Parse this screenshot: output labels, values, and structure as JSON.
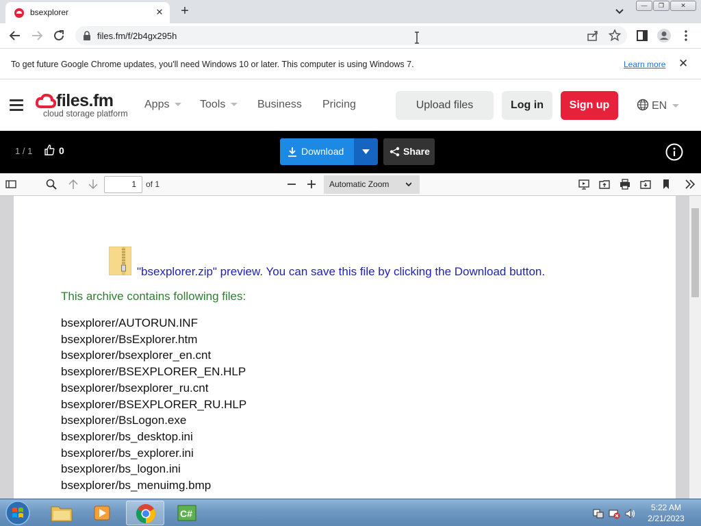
{
  "browser": {
    "tab_title": "bsexplorer",
    "url": "files.fm/f/2b4gx295h",
    "info_message": "To get future Google Chrome updates, you'll need Windows 10 or later. This computer is using Windows 7.",
    "learn_more": "Learn more"
  },
  "site": {
    "logo_brand": "files.fm",
    "logo_tagline": "cloud storage platform",
    "nav": [
      "Apps",
      "Tools",
      "Business",
      "Pricing"
    ],
    "upload_label": "Upload files",
    "login_label": "Log in",
    "signup_label": "Sign up",
    "language": "EN",
    "accent_color": "#e8213a"
  },
  "filebar": {
    "page_count": "1 / 1",
    "likes": "0",
    "download_label": "Download",
    "share_label": "Share",
    "download_color": "#1e88e5"
  },
  "pdf_toolbar": {
    "page_number": "1",
    "of_pages": "of 1",
    "zoom": "Automatic Zoom"
  },
  "document": {
    "preview_text": "\"bsexplorer.zip\" preview. You can save this file by clicking the Download button.",
    "contains_text": "This archive contains following files:",
    "files": [
      "bsexplorer/AUTORUN.INF",
      "bsexplorer/BsExplorer.htm",
      "bsexplorer/bsexplorer_en.cnt",
      "bsexplorer/BSEXPLORER_EN.HLP",
      "bsexplorer/bsexplorer_ru.cnt",
      "bsexplorer/BSEXPLORER_RU.HLP",
      "bsexplorer/BsLogon.exe",
      "bsexplorer/bs_desktop.ini",
      "bsexplorer/bs_explorer.ini",
      "bsexplorer/bs_logon.ini",
      "bsexplorer/bs_menuimg.bmp"
    ]
  },
  "taskbar": {
    "time": "5:22 AM",
    "date": "2/21/2023"
  }
}
